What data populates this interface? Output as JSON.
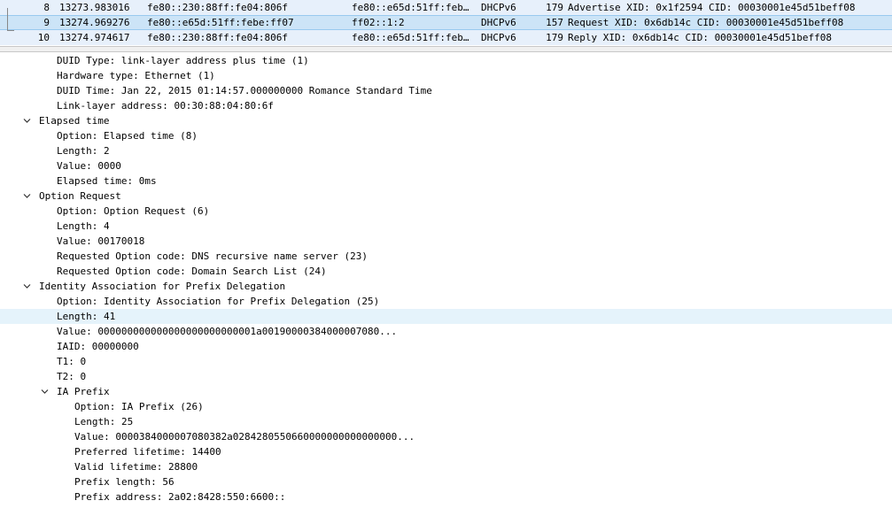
{
  "packets": [
    {
      "no": "8",
      "time": "13273.983016",
      "src": "fe80::230:88ff:fe04:806f",
      "dst": "fe80::e65d:51ff:feb…",
      "proto": "DHCPv6",
      "len": "179",
      "info": "Advertise XID: 0x1f2594 CID: 00030001e45d51beff08"
    },
    {
      "no": "9",
      "time": "13274.969276",
      "src": "fe80::e65d:51ff:febe:ff07",
      "dst": "ff02::1:2",
      "proto": "DHCPv6",
      "len": "157",
      "info": "Request XID: 0x6db14c CID: 00030001e45d51beff08"
    },
    {
      "no": "10",
      "time": "13274.974617",
      "src": "fe80::230:88ff:fe04:806f",
      "dst": "fe80::e65d:51ff:feb…",
      "proto": "DHCPv6",
      "len": "179",
      "info": "Reply XID: 0x6db14c CID: 00030001e45d51beff08"
    }
  ],
  "details": [
    "DUID Type: link-layer address plus time (1)",
    "Hardware type: Ethernet (1)",
    "DUID Time: Jan 22, 2015 01:14:57.000000000 Romance Standard Time",
    "Link-layer address: 00:30:88:04:80:6f",
    "Elapsed time",
    "Option: Elapsed time (8)",
    "Length: 2",
    "Value: 0000",
    "Elapsed time: 0ms",
    "Option Request",
    "Option: Option Request (6)",
    "Length: 4",
    "Value: 00170018",
    "Requested Option code: DNS recursive name server (23)",
    "Requested Option code: Domain Search List (24)",
    "Identity Association for Prefix Delegation",
    "Option: Identity Association for Prefix Delegation (25)",
    "Length: 41",
    "Value: 000000000000000000000000001a00190000384000007080...",
    "IAID: 00000000",
    "T1: 0",
    "T2: 0",
    "IA Prefix",
    "Option: IA Prefix (26)",
    "Length: 25",
    "Value: 0000384000007080382a0284280550660000000000000000...",
    "Preferred lifetime: 14400",
    "Valid lifetime: 28800",
    "Prefix length: 56",
    "Prefix address: 2a02:8428:550:6600::"
  ],
  "colors": {
    "selected_row": "#cce4f7",
    "alt_row": "#e7f0fb",
    "highlight_row": "#e5f3fb"
  }
}
